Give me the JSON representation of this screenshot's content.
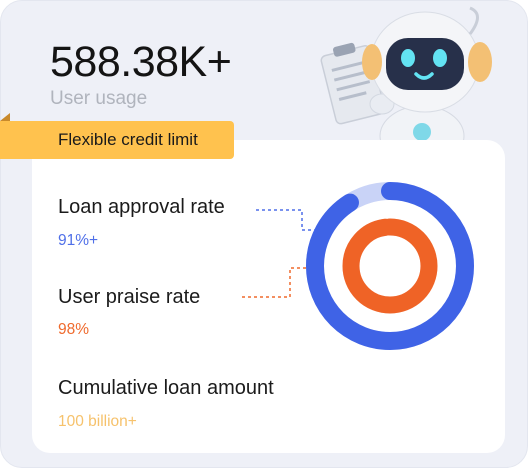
{
  "header": {
    "metric": "588.38K+",
    "caption": "User usage"
  },
  "tag": {
    "label": "Flexible credit limit"
  },
  "stats": [
    {
      "label": "Loan approval rate",
      "value": "91%+",
      "color": "#4f6fe8"
    },
    {
      "label": "User praise rate",
      "value": "98%",
      "color": "#ef6a2d"
    },
    {
      "label": "Cumulative loan amount",
      "value": "100 billion+",
      "color": "#f6c26c"
    }
  ],
  "ring": {
    "outer_fraction": 0.91,
    "inner_fraction": 0.98,
    "outer_color": "#3f63e6",
    "outer_track": "#c9d3f7",
    "inner_color": "#ef6326",
    "inner_track": "#fbd3c0"
  },
  "robot": {
    "icon": "robot-mascot-icon"
  }
}
